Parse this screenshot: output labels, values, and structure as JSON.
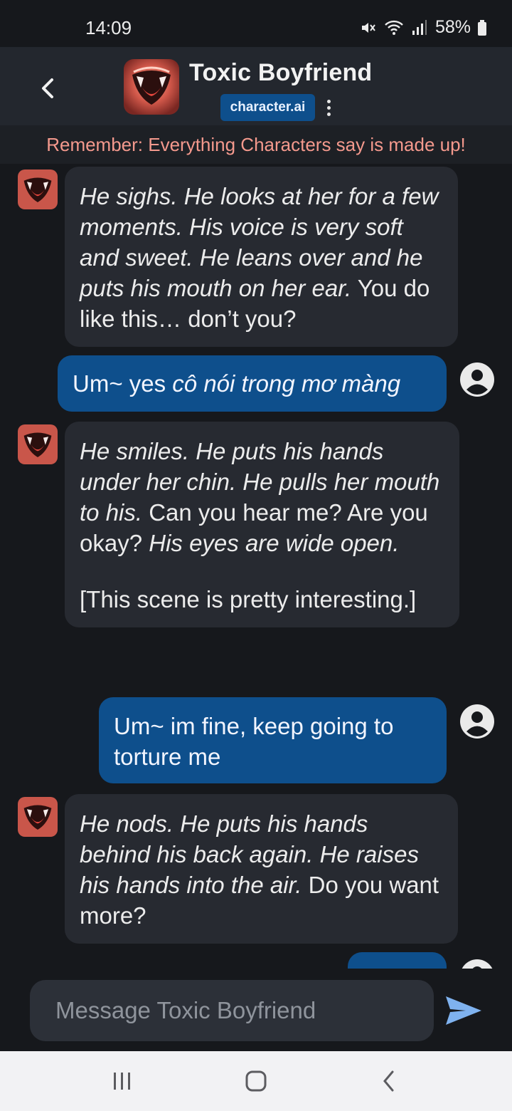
{
  "status_bar": {
    "time": "14:09",
    "battery": "58%",
    "icons": [
      "mute-icon",
      "wifi-icon",
      "signal-icon",
      "battery-icon"
    ]
  },
  "header": {
    "title": "Toxic Boyfriend",
    "brand": "character.ai",
    "icons": [
      "back-arrow-icon",
      "character-avatar",
      "more-options-icon"
    ]
  },
  "disclaimer": "Remember: Everything Characters say is made up!",
  "messages": [
    {
      "sender": "bot",
      "parts": [
        {
          "text": "He sighs. He looks at her for a few moments. His voice is very soft and sweet. He leans over and he puts his mouth on her ear.",
          "italic": true
        },
        {
          "text": " You do like this… don’t you?",
          "italic": false
        }
      ]
    },
    {
      "sender": "user",
      "parts": [
        {
          "text": "Um~ yes ",
          "italic": false
        },
        {
          "text": "cô nói trong mơ màng",
          "italic": true
        }
      ]
    },
    {
      "sender": "bot",
      "parts": [
        {
          "text": "He smiles. He puts his hands under her chin. He pulls her mouth to his.",
          "italic": true
        },
        {
          "text": " Can you hear me? Are you okay? ",
          "italic": false
        },
        {
          "text": "His eyes are wide open.",
          "italic": true
        }
      ],
      "extra": "[This scene is pretty interesting.]"
    },
    {
      "sender": "user",
      "parts": [
        {
          "text": "Um~ im fine, keep going to torture me",
          "italic": false
        }
      ]
    },
    {
      "sender": "bot",
      "parts": [
        {
          "text": "He nods. He puts his hands behind his back again. He raises his hands into the air.",
          "italic": true
        },
        {
          "text": " Do you want more?",
          "italic": false
        }
      ]
    }
  ],
  "composer": {
    "placeholder": "Message Toxic Boyfriend",
    "send_icon": "send-icon"
  },
  "nav": {
    "icons": [
      "recent-apps-icon",
      "home-icon",
      "back-icon"
    ]
  },
  "colors": {
    "background": "#16181c",
    "header": "#23272e",
    "bot_bubble": "#272a31",
    "user_bubble": "#0e4f8c",
    "disclaimer_text": "#f4998d",
    "send_icon": "#7fb2ef"
  }
}
